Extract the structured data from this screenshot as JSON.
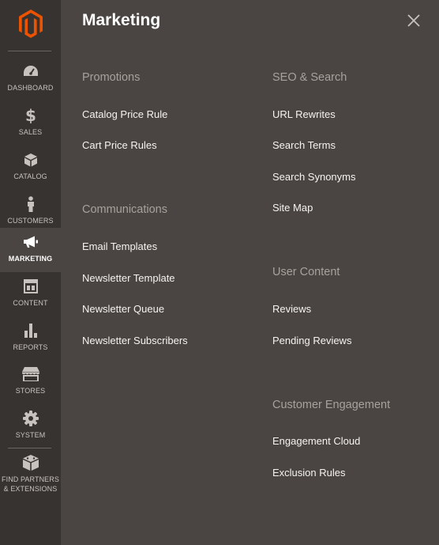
{
  "sidebar": {
    "items": [
      {
        "key": "dashboard",
        "label": "DASHBOARD",
        "icon": "dashboard-icon"
      },
      {
        "key": "sales",
        "label": "SALES",
        "icon": "dollar-icon"
      },
      {
        "key": "catalog",
        "label": "CATALOG",
        "icon": "box-icon"
      },
      {
        "key": "customers",
        "label": "CUSTOMERS",
        "icon": "person-icon"
      },
      {
        "key": "marketing",
        "label": "MARKETING",
        "icon": "megaphone-icon"
      },
      {
        "key": "content",
        "label": "CONTENT",
        "icon": "layout-icon"
      },
      {
        "key": "reports",
        "label": "REPORTS",
        "icon": "bar-chart-icon"
      },
      {
        "key": "stores",
        "label": "STORES",
        "icon": "storefront-icon"
      },
      {
        "key": "system",
        "label": "SYSTEM",
        "icon": "gear-icon"
      },
      {
        "key": "partners",
        "label_line1": "FIND PARTNERS",
        "label_line2": "& EXTENSIONS",
        "icon": "blocks-icon"
      }
    ],
    "active": "marketing"
  },
  "panel": {
    "title": "Marketing",
    "groups": {
      "promotions": {
        "title": "Promotions",
        "links": [
          "Catalog Price Rule",
          "Cart Price Rules"
        ]
      },
      "communications": {
        "title": "Communications",
        "links": [
          "Email Templates",
          "Newsletter Template",
          "Newsletter Queue",
          "Newsletter Subscribers"
        ]
      },
      "seo": {
        "title": "SEO & Search",
        "links": [
          "URL Rewrites",
          "Search Terms",
          "Search Synonyms",
          "Site Map"
        ]
      },
      "user_content": {
        "title": "User Content",
        "links": [
          "Reviews",
          "Pending Reviews"
        ]
      },
      "engagement": {
        "title": "Customer Engagement",
        "links": [
          "Engagement Cloud",
          "Exclusion Rules"
        ]
      }
    }
  },
  "colors": {
    "sidebar_bg": "#373330",
    "panel_bg": "#4a4542",
    "logo_orange": "#eb5202",
    "group_title": "#a8a19c",
    "link_text": "#f5f3f1"
  }
}
